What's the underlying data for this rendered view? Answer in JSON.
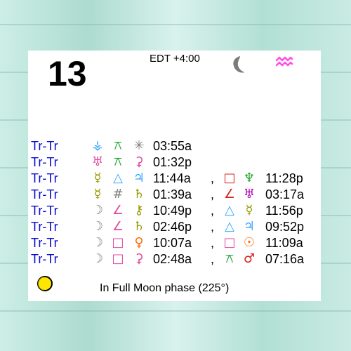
{
  "header": {
    "day": "13",
    "timezone": "EDT +4:00",
    "moon_icon": "moon-icon",
    "sign_icon": "aquarius-icon"
  },
  "colors": {
    "label_blue": "#0a0ad6",
    "aqua_pink": "#ff4fe6",
    "moon_gray": "#7b7b7b",
    "green": "#1aa12b",
    "pink": "#e04a9f",
    "blue": "#3aa6ff",
    "orange": "#ff6a00",
    "gold": "#ffcc00",
    "olive": "#9a9a00",
    "gray": "#7d7d7d",
    "red": "#d81e1e"
  },
  "rows": [
    {
      "label": "Tr-Tr",
      "time1": "03:55a",
      "comma": "",
      "time2": "",
      "glyphs": [
        {
          "name": "neptune-icon",
          "char": "⚶",
          "color": "#3aa6ff"
        },
        {
          "name": "trine-aspect-icon",
          "char": "⚻",
          "color": "#1aa12b"
        },
        {
          "name": "ceres-icon",
          "char": "✳",
          "color": "#7d7d7d"
        }
      ]
    },
    {
      "label": "Tr-Tr",
      "time1": "01:32p",
      "comma": "",
      "time2": "",
      "glyphs": [
        {
          "name": "uranus-icon",
          "char": "♅",
          "color": "#e04a9f"
        },
        {
          "name": "trine-aspect-icon",
          "char": "⚻",
          "color": "#1aa12b"
        },
        {
          "name": "juno-icon",
          "char": "⚳",
          "color": "#e04a9f"
        }
      ]
    },
    {
      "label": "Tr-Tr",
      "time1": "11:44a",
      "comma": ",",
      "time2": "11:28p",
      "glyphs": [
        {
          "name": "mercury-icon",
          "char": "☿",
          "color": "#9a9a00"
        },
        {
          "name": "trine-icon",
          "char": "△",
          "color": "#3aa6ff"
        },
        {
          "name": "jupiter-icon",
          "char": "♃",
          "color": "#3aa6ff"
        },
        {
          "name": "square-icon",
          "char": "□",
          "color": "#d81e1e"
        },
        {
          "name": "neptune-icon",
          "char": "♆",
          "color": "#1aa12b"
        }
      ]
    },
    {
      "label": "Tr-Tr",
      "time1": "01:39a",
      "comma": ",",
      "time2": "03:17a",
      "glyphs": [
        {
          "name": "mercury-icon",
          "char": "☿",
          "color": "#9a9a00"
        },
        {
          "name": "sesquiquadrate-icon",
          "char": "#",
          "color": "#7d7d7d"
        },
        {
          "name": "saturn-icon",
          "char": "♄",
          "color": "#9a9a00"
        },
        {
          "name": "semisquare-icon",
          "char": "∠",
          "color": "#d81e1e"
        },
        {
          "name": "uranus-icon",
          "char": "♅",
          "color": "#b000b0"
        }
      ]
    },
    {
      "label": "Tr-Tr",
      "time1": "10:49p",
      "comma": ",",
      "time2": "11:56p",
      "glyphs": [
        {
          "name": "moon-icon",
          "char": "☽",
          "color": "#7b7b7b"
        },
        {
          "name": "semisquare-icon",
          "char": "∠",
          "color": "#e04a9f"
        },
        {
          "name": "chiron-icon",
          "char": "⚷",
          "color": "#9a9a00"
        },
        {
          "name": "trine-icon",
          "char": "△",
          "color": "#3aa6ff"
        },
        {
          "name": "mercury-icon",
          "char": "☿",
          "color": "#9a9a00"
        }
      ]
    },
    {
      "label": "Tr-Tr",
      "time1": "02:46p",
      "comma": ",",
      "time2": "09:52p",
      "glyphs": [
        {
          "name": "moon-icon",
          "char": "☽",
          "color": "#7b7b7b"
        },
        {
          "name": "semisquare-icon",
          "char": "∠",
          "color": "#e04a9f"
        },
        {
          "name": "saturn-icon",
          "char": "♄",
          "color": "#9a9a00"
        },
        {
          "name": "trine-icon",
          "char": "△",
          "color": "#3aa6ff"
        },
        {
          "name": "jupiter-icon",
          "char": "♃",
          "color": "#3aa6ff"
        }
      ]
    },
    {
      "label": "Tr-Tr",
      "time1": "10:07a",
      "comma": ",",
      "time2": "11:09a",
      "glyphs": [
        {
          "name": "moon-icon",
          "char": "☽",
          "color": "#7b7b7b"
        },
        {
          "name": "square-icon",
          "char": "□",
          "color": "#e04a9f"
        },
        {
          "name": "venus-icon",
          "char": "♀",
          "color": "#ff6a00"
        },
        {
          "name": "square-icon",
          "char": "□",
          "color": "#e04a9f"
        },
        {
          "name": "sun-icon",
          "char": "☉",
          "color": "#ff6a00"
        }
      ]
    },
    {
      "label": "Tr-Tr",
      "time1": "02:48a",
      "comma": ",",
      "time2": "07:16a",
      "glyphs": [
        {
          "name": "moon-icon",
          "char": "☽",
          "color": "#7b7b7b"
        },
        {
          "name": "square-icon",
          "char": "□",
          "color": "#e04a9f"
        },
        {
          "name": "juno-icon",
          "char": "⚳",
          "color": "#e04a9f"
        },
        {
          "name": "trine-aspect-icon",
          "char": "⚻",
          "color": "#1aa12b"
        },
        {
          "name": "mars-icon",
          "char": "♂",
          "color": "#d81e1e"
        }
      ]
    }
  ],
  "footer": {
    "phase_text": "In Full Moon phase (225°)",
    "moon_phase_icon": "moon-phase-icon"
  }
}
